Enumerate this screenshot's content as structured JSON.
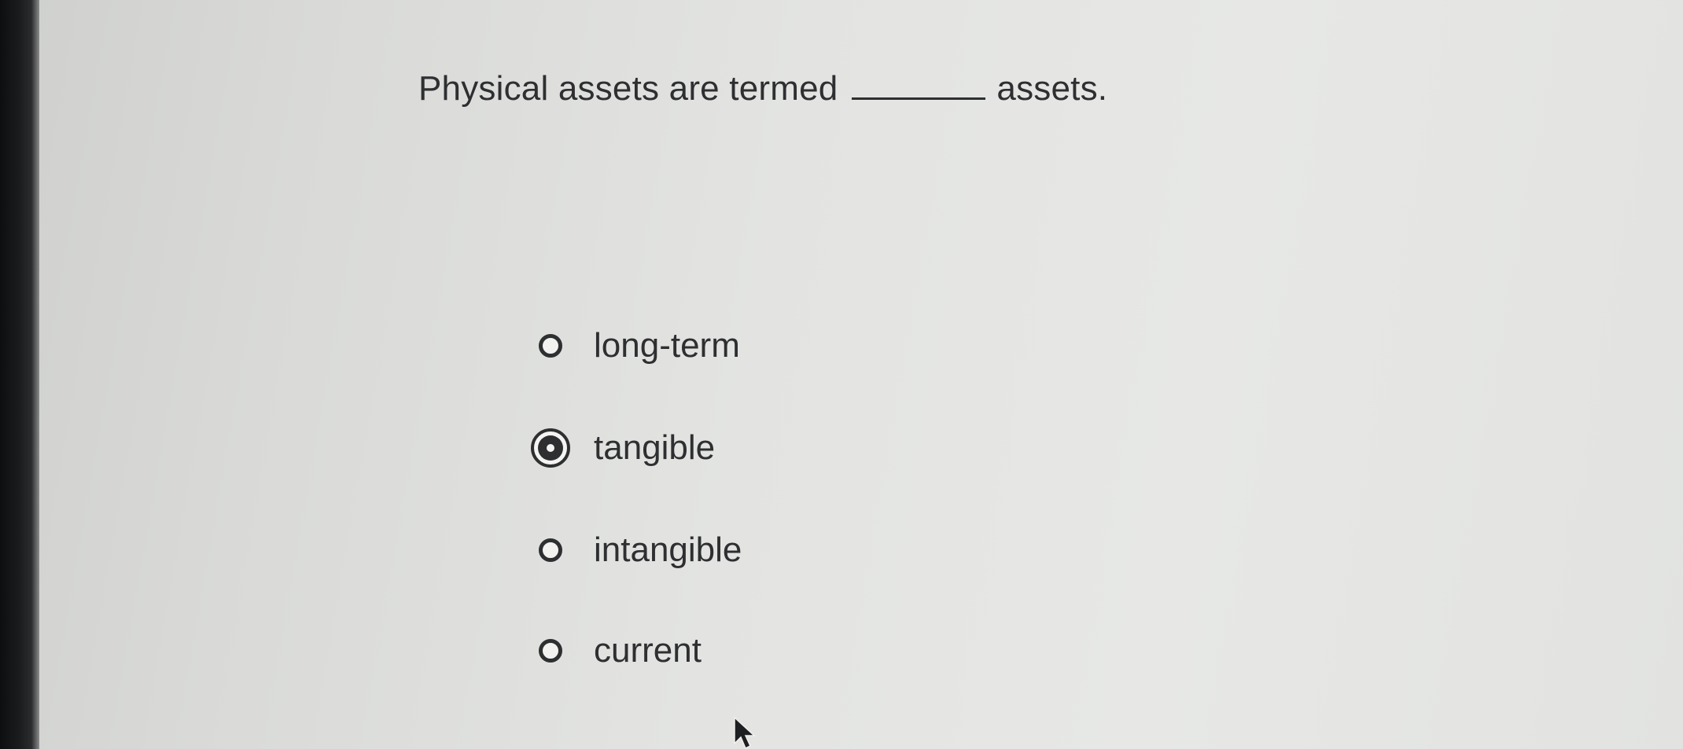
{
  "question": {
    "prefix": "Physical assets are termed",
    "suffix": "assets."
  },
  "options": [
    {
      "label": "long-term",
      "selected": false
    },
    {
      "label": "tangible",
      "selected": true
    },
    {
      "label": "intangible",
      "selected": false
    },
    {
      "label": "current",
      "selected": false
    }
  ],
  "selected_option": "tangible",
  "icons": {
    "cursor": "mouse-pointer-icon"
  },
  "colors": {
    "text": "#2e2f31",
    "background": "#e3e4e2"
  }
}
